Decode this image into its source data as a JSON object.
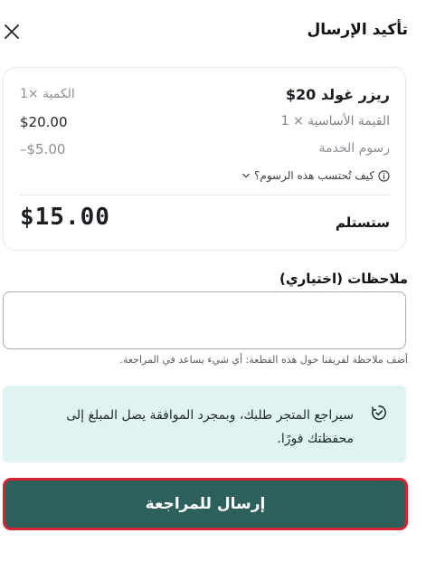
{
  "header": {
    "title": "تأكيد الإرسال",
    "close_icon": "close-icon"
  },
  "summary": {
    "item_name": "ريزر غولد 20$",
    "quantity": "الكمية ×1",
    "base_value_label": "القيمة الأساسية × 1",
    "base_value": "$20.00",
    "service_fee_label": "رسوم الخدمة",
    "service_fee": "–$5.00",
    "fee_help": "كيف تُحتسب هذه الرسوم؟",
    "receive_label": "ستستلم",
    "receive_amount": "$15.00"
  },
  "notes": {
    "label": "ملاحظات (اختياري)",
    "value": "",
    "placeholder": "",
    "hint": "أضف ملاحظة لفريقنا حول هذه القطعة: أي شيء يساعد في المراجعة."
  },
  "info": {
    "text": "سيراجع المتجر طلبك، وبمجرد الموافقة يصل المبلغ إلى محفظتك فورًا.",
    "icon": "clock-check-icon",
    "background_color": "#def3f2"
  },
  "submit": {
    "label": "إرسال للمراجعة",
    "background_color": "#2d5f5d",
    "border_color": "#d62433"
  }
}
